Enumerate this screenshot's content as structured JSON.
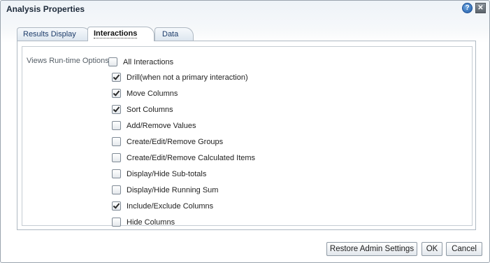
{
  "dialog": {
    "title": "Analysis Properties",
    "help_label": "?",
    "close_label": "✕"
  },
  "tabs": [
    {
      "label": "Results Display",
      "active": false
    },
    {
      "label": "Interactions",
      "active": true
    },
    {
      "label": "Data",
      "active": false
    }
  ],
  "panel": {
    "section_label": "Views Run-time Options",
    "options": [
      {
        "label": "All Interactions",
        "checked": false
      },
      {
        "label": "Drill(when not a primary interaction)",
        "checked": true
      },
      {
        "label": "Move Columns",
        "checked": true
      },
      {
        "label": "Sort Columns",
        "checked": true
      },
      {
        "label": "Add/Remove Values",
        "checked": false
      },
      {
        "label": "Create/Edit/Remove Groups",
        "checked": false
      },
      {
        "label": "Create/Edit/Remove Calculated Items",
        "checked": false
      },
      {
        "label": "Display/Hide Sub-totals",
        "checked": false
      },
      {
        "label": "Display/Hide Running Sum",
        "checked": false
      },
      {
        "label": "Include/Exclude Columns",
        "checked": true
      },
      {
        "label": "Hide Columns",
        "checked": false
      }
    ]
  },
  "footer": {
    "restore_label": "Restore Admin Settings",
    "ok_label": "OK",
    "cancel_label": "Cancel"
  }
}
